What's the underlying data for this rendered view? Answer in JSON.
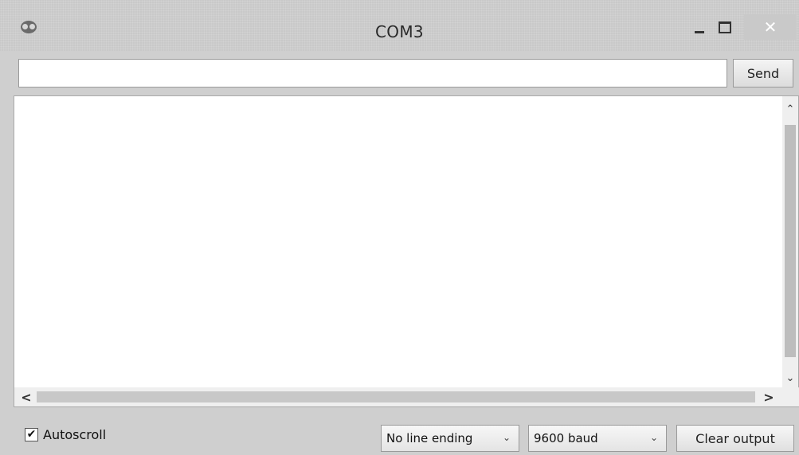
{
  "window": {
    "title": "COM3",
    "app_icon": "arduino-infinity-icon",
    "controls": {
      "minimize_icon": "minimize-icon",
      "maximize_icon": "maximize-icon",
      "close_label": "✕"
    }
  },
  "input": {
    "value": "",
    "placeholder": "",
    "send_label": "Send"
  },
  "output": {
    "text": ""
  },
  "scrollbars": {
    "up": "⌃",
    "down": "⌄",
    "left": "<",
    "right": ">"
  },
  "footer": {
    "autoscroll_label": "Autoscroll",
    "autoscroll_checked": true,
    "check_mark": "✔",
    "line_ending": "No line ending",
    "baud_rate": "9600 baud",
    "dropdown_chevron": "⌄",
    "clear_label": "Clear output"
  },
  "colors": {
    "titlebar": "#c9c9c9",
    "output_bg": "#ffffff"
  }
}
